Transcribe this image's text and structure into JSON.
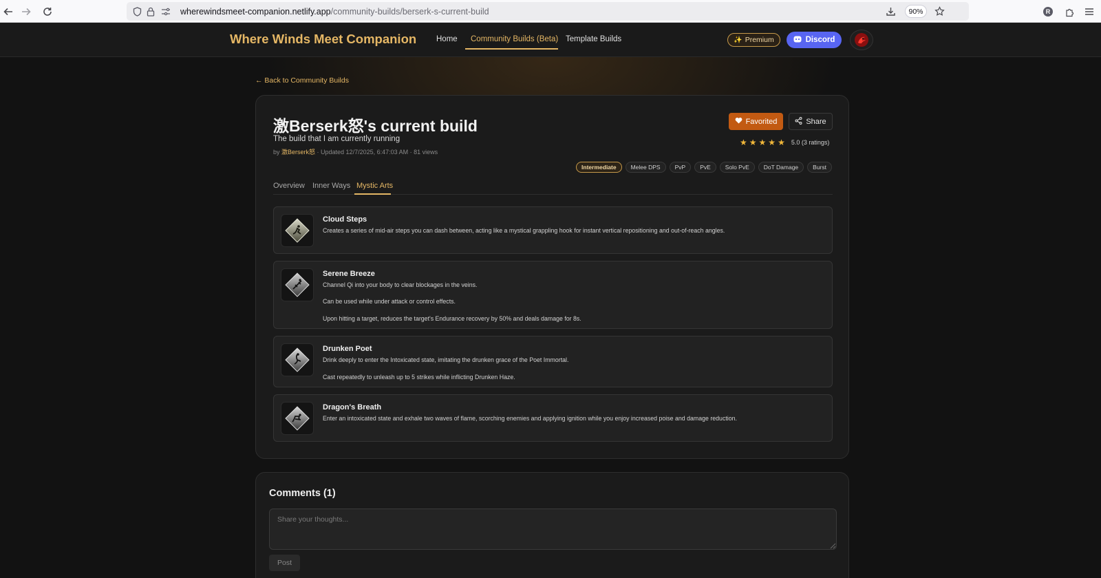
{
  "browser": {
    "url_host": "wherewindsmeet-companion.netlify.app",
    "url_path": "/community-builds/berserk-s-current-build",
    "zoom": "90%",
    "profile_initial": "R"
  },
  "header": {
    "logo": "Where Winds Meet Companion",
    "nav": [
      "Home",
      "Community Builds (Beta)",
      "Template Builds"
    ],
    "active_nav": "Community Builds (Beta)",
    "premium_label": "Premium",
    "discord_label": "Discord",
    "accent_color": "#e5b765",
    "discord_color": "#5865f2"
  },
  "back_link": "← Back to Community Builds",
  "build": {
    "title": "激Berserk怒's current build",
    "description": "The build that I am currently running",
    "meta_by": "by ",
    "author": "激Berserk怒",
    "meta_rest": " · Updated 12/7/2025, 6:47:03 AM · 81 views",
    "favorited_label": "Favorited",
    "share_label": "Share",
    "rating_stars": 5,
    "rating_text": "5.0 (3 ratings)",
    "tags": [
      "Intermediate",
      "Melee DPS",
      "PvP",
      "PvE",
      "Solo PvE",
      "DoT Damage",
      "Burst"
    ],
    "highlight_tag": "Intermediate",
    "tabs": [
      "Overview",
      "Inner Ways",
      "Mystic Arts"
    ],
    "active_tab": "Mystic Arts"
  },
  "mystic_arts": [
    {
      "name": "Cloud Steps",
      "icon": "cloud-steps-icon",
      "lines": [
        "Creates a series of mid-air steps you can dash between, acting like a mystical grappling hook for instant vertical repositioning and out-of-reach angles."
      ]
    },
    {
      "name": "Serene Breeze",
      "icon": "serene-breeze-icon",
      "lines": [
        "Channel Qi into your body to clear blockages in the veins.",
        "Can be used while under attack or control effects.",
        "Upon hitting a target, reduces the target's Endurance recovery by 50% and deals damage for 8s."
      ]
    },
    {
      "name": "Drunken Poet",
      "icon": "drunken-poet-icon",
      "lines": [
        "Drink deeply to enter the Intoxicated state, imitating the drunken grace of the Poet Immortal.",
        "Cast repeatedly to unleash up to 5 strikes while inflicting Drunken Haze."
      ]
    },
    {
      "name": "Dragon's Breath",
      "icon": "dragons-breath-icon",
      "lines": [
        "Enter an intoxicated state and exhale two waves of flame, scorching enemies and applying ignition while you enjoy increased poise and damage reduction."
      ]
    }
  ],
  "comments": {
    "title": "Comments (1)",
    "placeholder": "Share your thoughts...",
    "post_label": "Post"
  }
}
